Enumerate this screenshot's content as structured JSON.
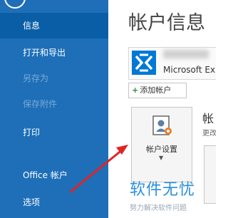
{
  "nav": {
    "items": [
      {
        "label": "信息"
      },
      {
        "label": "打开和导出"
      },
      {
        "label": "另存为"
      },
      {
        "label": "保存附件"
      },
      {
        "label": "打印"
      },
      {
        "label": "Office 帐户"
      },
      {
        "label": "选项"
      }
    ]
  },
  "main": {
    "title": "帐户信息",
    "account": {
      "type": "Microsoft Ex"
    },
    "add_account_label": "添加帐户",
    "settings": {
      "label": "帐户设置"
    },
    "section": {
      "heading": "帐",
      "desc": "更改"
    }
  },
  "watermark": {
    "text": "软件无忧",
    "sub": "努力解决软件问题"
  },
  "colors": {
    "sidebar": "#1e6fb8",
    "selected": "#0a5ea6",
    "arrow": "#e02424",
    "watermark": "#2a8fe0"
  }
}
